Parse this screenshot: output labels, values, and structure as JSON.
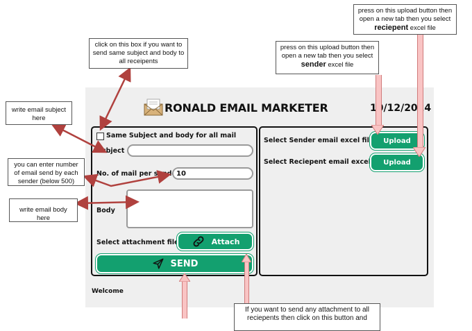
{
  "app": {
    "title": "RONALD EMAIL MARKETER",
    "date": "10/12/2024",
    "welcome": "Welcome"
  },
  "left_panel": {
    "same_checkbox_label": "Same Subject and body for all mail",
    "subject_label": "Subject",
    "subject_value": "",
    "mail_per_sender_label": "No. of mail per sender",
    "mail_per_sender_value": "10",
    "body_label": "Body",
    "body_value": "",
    "attachment_label": "Select attachment file",
    "attach_button": "Attach",
    "send_button": "SEND"
  },
  "right_panel": {
    "sender_label": "Select Sender email excel file",
    "sender_upload": "Upload",
    "recipient_label": "Select Reciepent email excel file",
    "recipient_upload": "Upload"
  },
  "annotations": {
    "same_box": "click on this box if you want to send same subject and body to all receipents",
    "subject": "write email subject here",
    "mail_count": "you can enter number of email send by each sender (below 500)",
    "body": "write email body here",
    "sender_upload_pre": "press on this upload button then open a new tab then you select",
    "sender_upload_bold": "sender",
    "sender_upload_post": "excel file",
    "recipient_upload_pre": "press on this upload button then open a new tab then you select",
    "recipient_upload_bold": "reciepent",
    "recipient_upload_post": "excel file",
    "attachment": "If you want to send any attachment to all reciepents then click on this button and"
  },
  "colors": {
    "accent_green": "#13a06f",
    "arrow_red": "#b0413e",
    "arrow_pink": "#f9c4c4"
  }
}
